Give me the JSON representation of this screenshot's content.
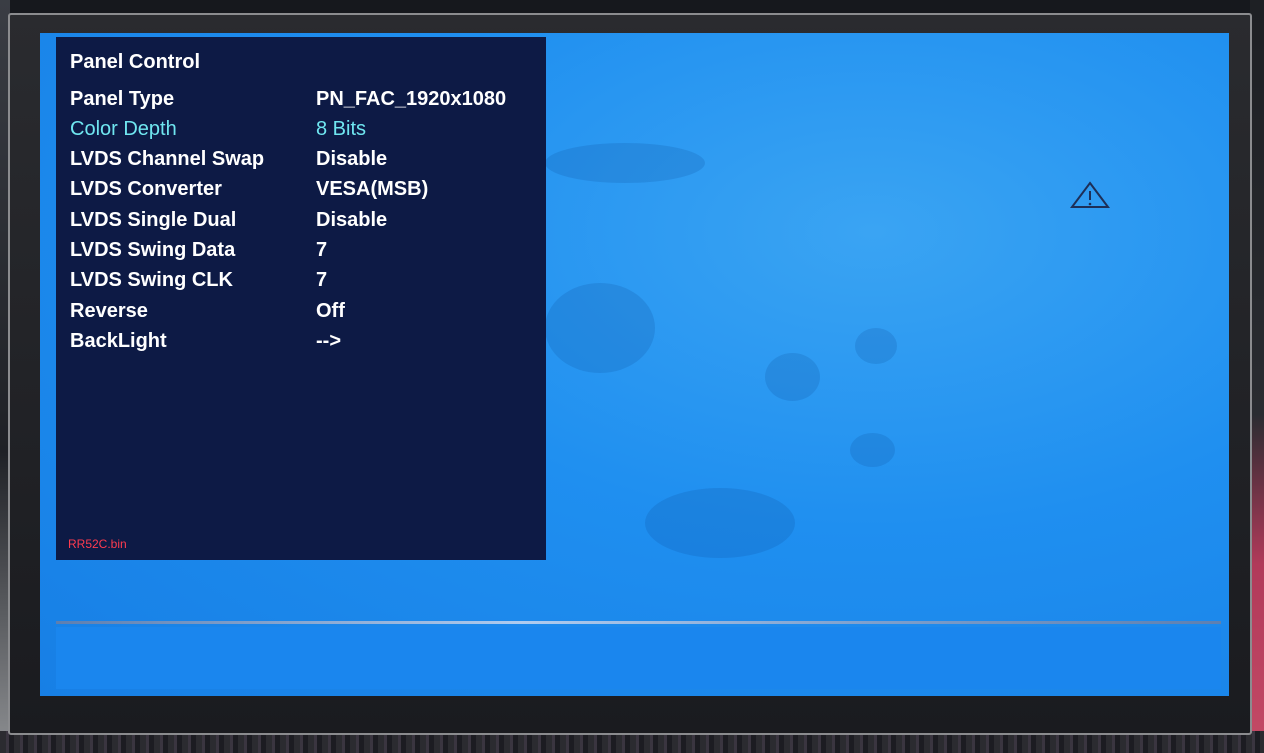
{
  "osd": {
    "title": "Panel Control",
    "items": [
      {
        "label": "Panel Type",
        "value": "PN_FAC_1920x1080",
        "selected": false
      },
      {
        "label": "Color Depth",
        "value": "8 Bits",
        "selected": true
      },
      {
        "label": "LVDS Channel Swap",
        "value": "Disable",
        "selected": false
      },
      {
        "label": "LVDS Converter",
        "value": "VESA(MSB)",
        "selected": false
      },
      {
        "label": "LVDS Single Dual",
        "value": "Disable",
        "selected": false
      },
      {
        "label": "LVDS Swing Data",
        "value": "7",
        "selected": false
      },
      {
        "label": "LVDS Swing CLK",
        "value": "7",
        "selected": false
      },
      {
        "label": "Reverse",
        "value": "Off",
        "selected": false
      },
      {
        "label": "BackLight",
        "value": "-->",
        "selected": false
      }
    ],
    "file": "RR52C.bin"
  },
  "colors": {
    "screen": "#1f8ff0",
    "osd_background": "#0d1a45",
    "text": "#ffffff",
    "highlight": "#6fe6f0",
    "file_text": "#ff3b4f"
  },
  "icons": {
    "warning": "warning-triangle-icon"
  }
}
